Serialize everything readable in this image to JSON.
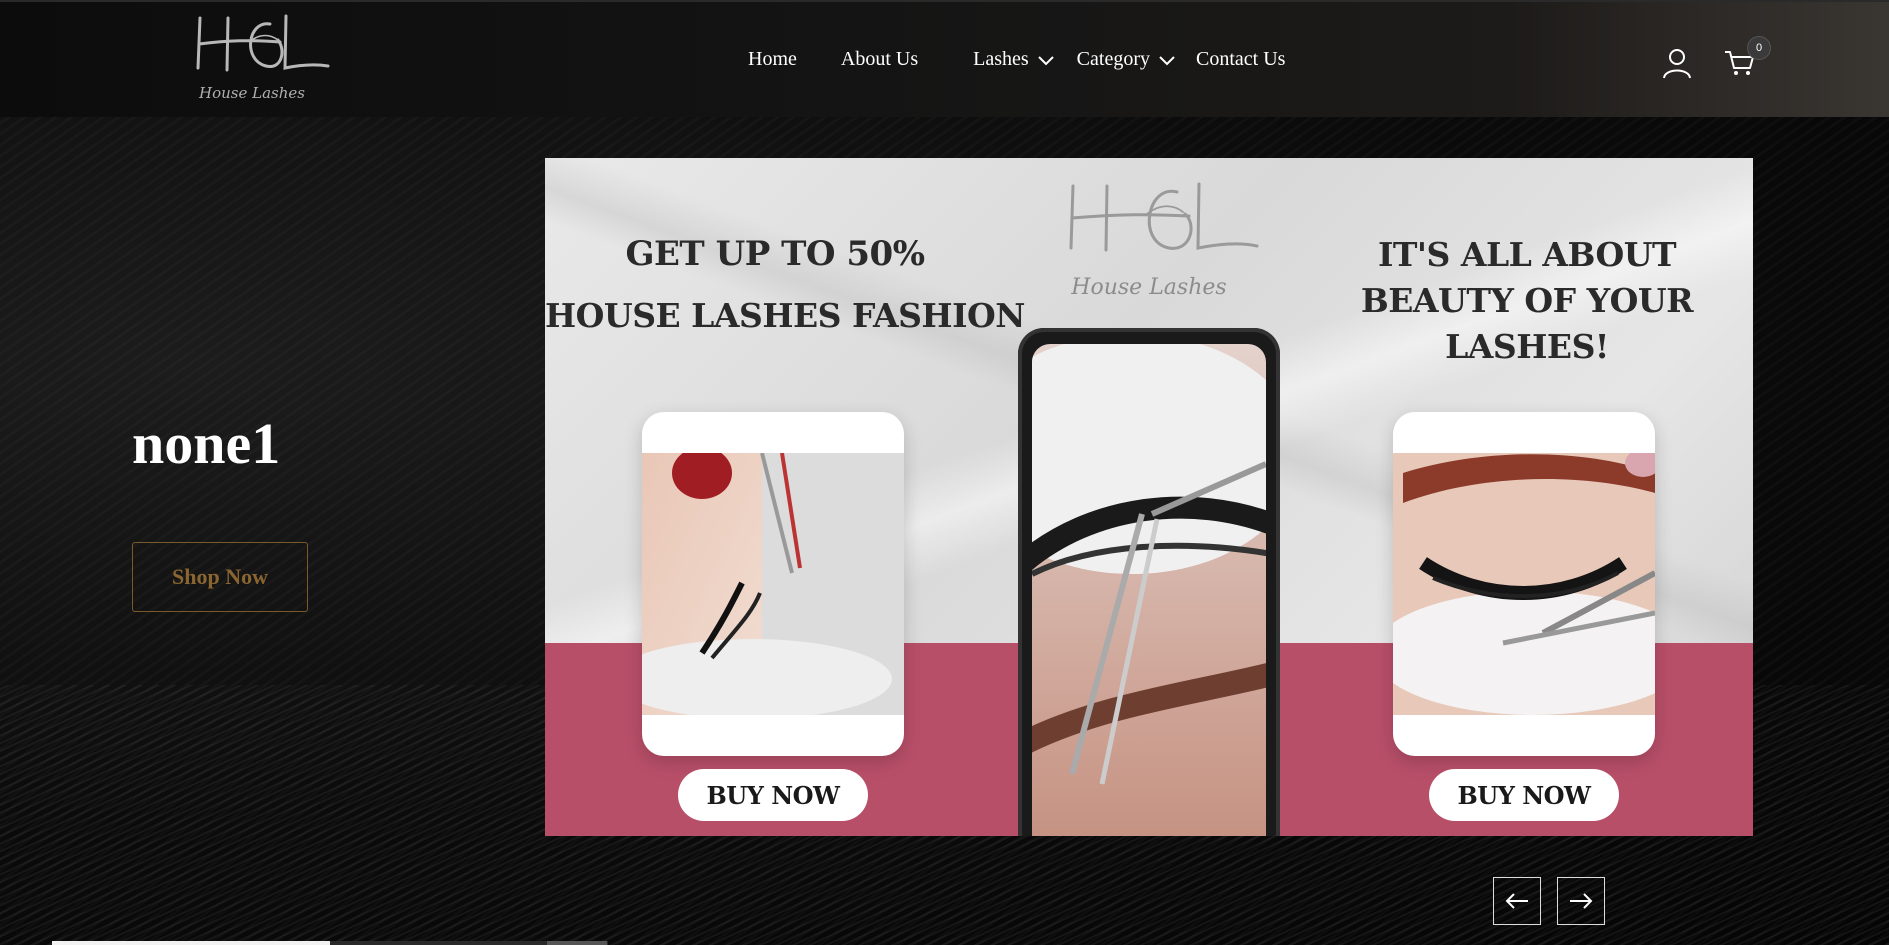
{
  "header": {
    "logo": {
      "monogram": "HL",
      "script": "House Lashes"
    },
    "nav": [
      {
        "label": "Home",
        "dropdown": false
      },
      {
        "label": "About Us",
        "dropdown": false
      },
      {
        "label": "Lashes",
        "dropdown": true
      },
      {
        "label": "Category",
        "dropdown": true
      },
      {
        "label": "Contact Us",
        "dropdown": false
      }
    ],
    "account_icon": "user-icon",
    "cart_icon": "cart-icon",
    "cart_count": "0"
  },
  "hero": {
    "title": "none1",
    "cta_label": "Shop Now",
    "cta_color": "#8a6530",
    "banner": {
      "promo_line1": "GET UP TO 50%",
      "promo_line2": "HOUSE LASHES FASHION",
      "tagline": "IT'S ALL ABOUT BEAUTY OF YOUR LASHES!",
      "logo_script": "House Lashes",
      "buy_left_label": "BUY NOW",
      "buy_right_label": "BUY NOW",
      "accent_color": "#b84f69"
    },
    "slider": {
      "prev_icon": "arrow-left-icon",
      "next_icon": "arrow-right-icon",
      "progress": 0.5
    }
  }
}
